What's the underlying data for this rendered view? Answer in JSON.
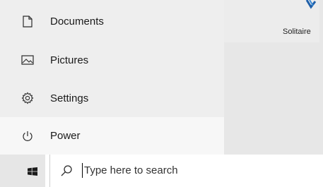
{
  "start_menu": {
    "items": [
      {
        "label": "Documents",
        "icon": "document-icon"
      },
      {
        "label": "Pictures",
        "icon": "pictures-icon"
      },
      {
        "label": "Settings",
        "icon": "gear-icon"
      },
      {
        "label": "Power",
        "icon": "power-icon"
      }
    ]
  },
  "tiles": {
    "solitaire": {
      "label": "Solitaire",
      "icon": "solitaire-logo"
    }
  },
  "taskbar": {
    "start_icon": "windows-logo-icon",
    "search": {
      "placeholder": "Type here to search",
      "icon": "search-icon"
    }
  },
  "colors": {
    "menu_background": "#eeeeee",
    "hover_background": "#f7f7f7",
    "taskbar_background": "#ffffff",
    "start_button_background": "#e6e6e6"
  }
}
